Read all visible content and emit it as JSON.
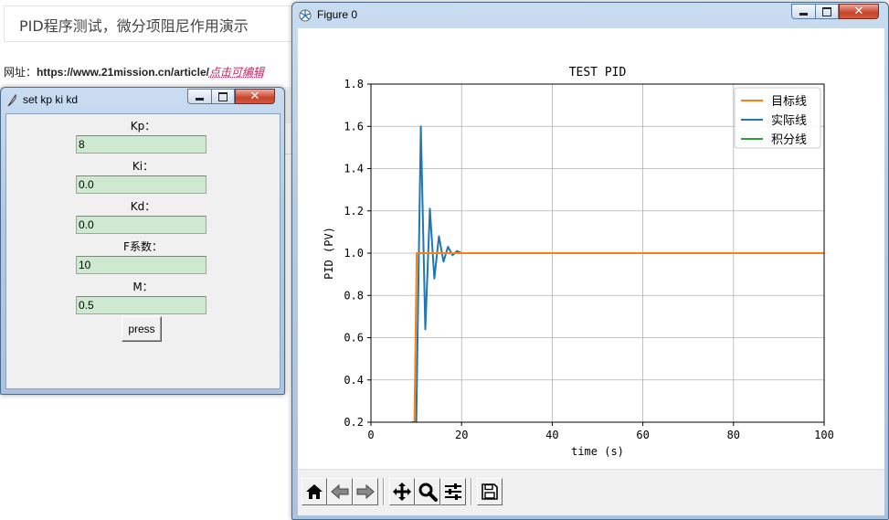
{
  "background": {
    "page_title": "PID程序测试，微分项阻尼作用演示",
    "url_label": "网址：",
    "url": "https://www.21mission.cn/article/",
    "edit_link": "点击可编辑"
  },
  "dialog": {
    "title": "set kp ki kd",
    "fields": [
      {
        "label": "Kp：",
        "value": "8"
      },
      {
        "label": "Ki：",
        "value": "0.0"
      },
      {
        "label": "Kd：",
        "value": "0.0"
      },
      {
        "label": "F系数：",
        "value": "10"
      },
      {
        "label": "M：",
        "value": "0.5"
      }
    ],
    "press_label": "press"
  },
  "figure": {
    "title": "Figure 0",
    "toolbar": [
      "home-icon",
      "back-arrow-icon",
      "forward-arrow-icon",
      "pan-icon",
      "zoom-icon",
      "subplots-icon",
      "save-icon"
    ]
  },
  "chart_data": {
    "type": "line",
    "title": "TEST PID",
    "xlabel": "time (s)",
    "ylabel": "PID (PV)",
    "xlim": [
      0,
      100
    ],
    "ylim": [
      0.2,
      1.8
    ],
    "xticks": [
      0,
      20,
      40,
      60,
      80,
      100
    ],
    "yticks": [
      0.2,
      0.4,
      0.6,
      0.8,
      1.0,
      1.2,
      1.4,
      1.6,
      1.8
    ],
    "grid": true,
    "legend": "top-right",
    "series": [
      {
        "name": "目标线",
        "color": "#ff7f0e",
        "x": [
          9.6,
          10.1,
          100
        ],
        "y": [
          0.2,
          1.0,
          1.0
        ]
      },
      {
        "name": "实际线",
        "color": "#1f77b4",
        "x": [
          9.0,
          10.0,
          11.0,
          12.0,
          13.0,
          14.0,
          15.0,
          16.0,
          17.0,
          18.0,
          19.0,
          20.0,
          100
        ],
        "y": [
          0.2,
          0.2,
          1.6,
          0.64,
          1.21,
          0.88,
          1.08,
          0.96,
          1.03,
          0.99,
          1.01,
          1.0,
          1.0
        ]
      },
      {
        "name": "积分线",
        "color": "#2ca02c",
        "x": [],
        "y": []
      }
    ]
  }
}
